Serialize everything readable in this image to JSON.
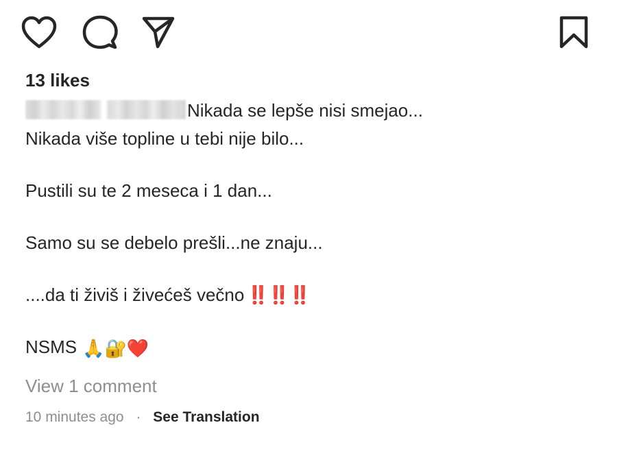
{
  "actions": {
    "like_icon": "heart-outline-icon",
    "comment_icon": "speech-bubble-icon",
    "share_icon": "paper-plane-icon",
    "save_icon": "bookmark-icon"
  },
  "likes": "13 likes",
  "caption": {
    "line1": "Nikada se lepše nisi smejao...",
    "line2": "Nikada više topline u tebi nije bilo...",
    "line3": "Pustili su te 2 meseca i 1 dan...",
    "line4": "Samo su se debelo prešli...ne znaju...",
    "line5": "....da ti živiš i živećeš večno",
    "line5_emphasis": "‼️‼️‼️",
    "signoff": "NSMS",
    "signoff_emojis": "🙏🔐❤️"
  },
  "view_comments": "View 1 comment",
  "timestamp": "10 minutes ago",
  "separator": "·",
  "see_translation": "See Translation",
  "colors": {
    "text": "#262626",
    "secondary": "#8e8e8e",
    "emphasis_red": "#e1261c"
  }
}
